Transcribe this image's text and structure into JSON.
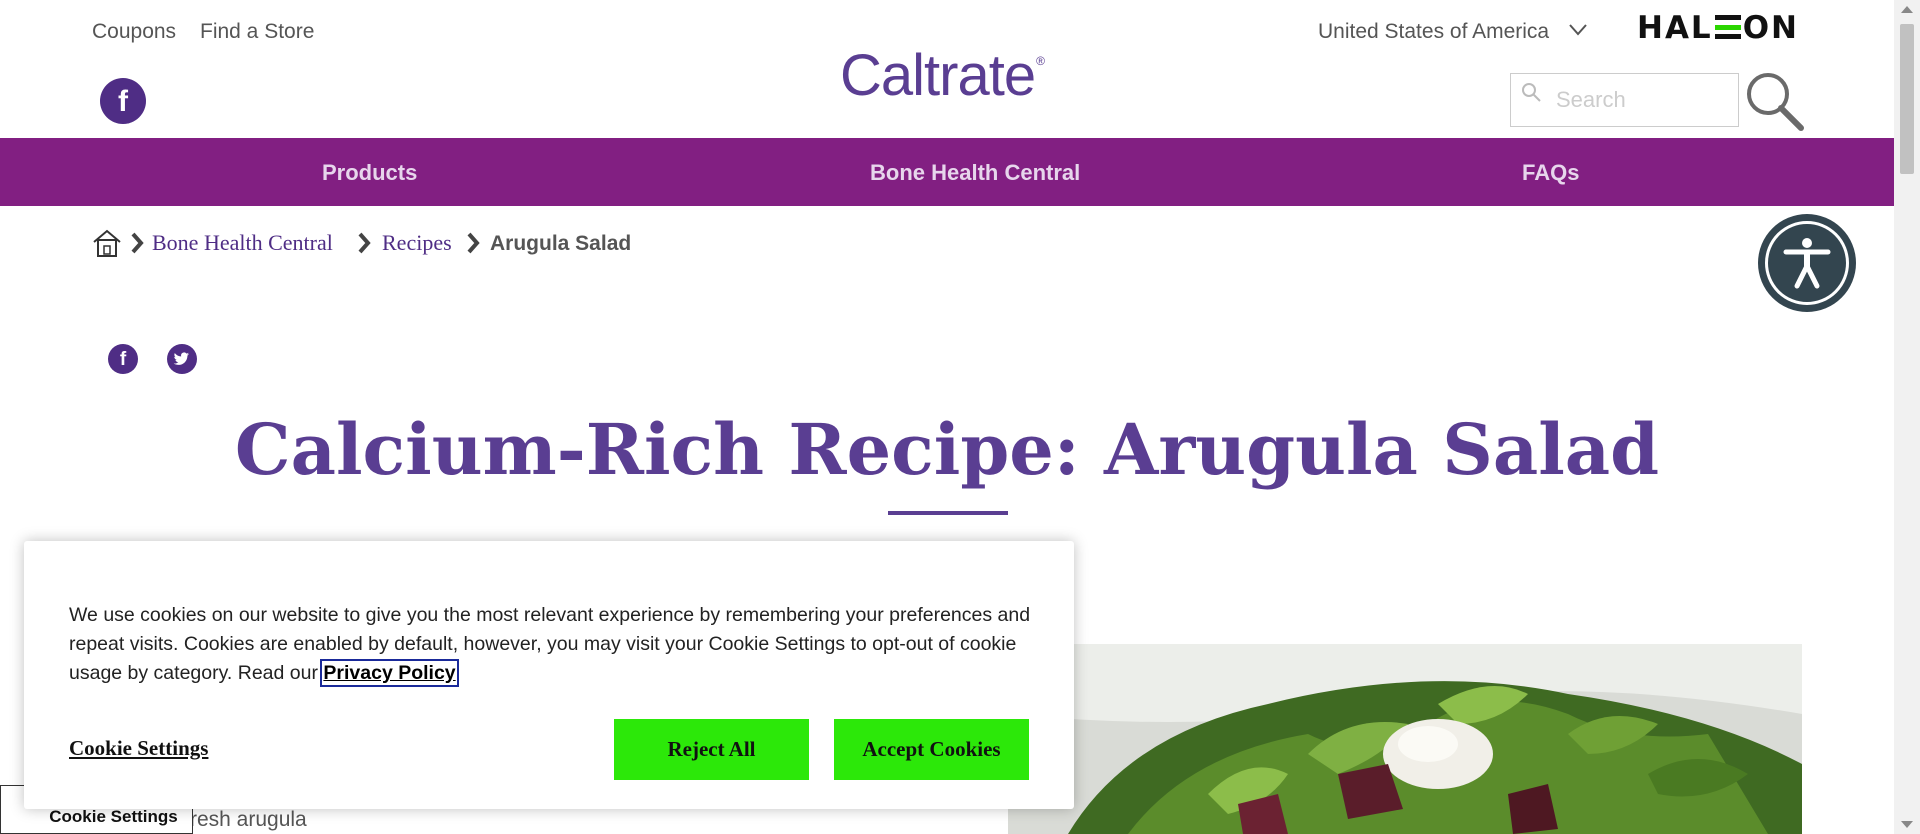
{
  "utility": {
    "coupons": "Coupons",
    "find_store": "Find a Store",
    "country": "United States of America",
    "brand_parent": "HALEON"
  },
  "logo": {
    "text": "Caltrate",
    "mark": "®"
  },
  "search": {
    "placeholder": "Search"
  },
  "nav": {
    "items": [
      {
        "label": "Products"
      },
      {
        "label": "Bone Health Central"
      },
      {
        "label": "FAQs"
      }
    ]
  },
  "breadcrumb": {
    "items": [
      {
        "label": "Bone Health Central"
      },
      {
        "label": "Recipes"
      },
      {
        "label": "Arugula Salad"
      }
    ]
  },
  "page": {
    "title": "Calcium-Rich Recipe: Arugula Salad",
    "visible_ingredient": "resh arugula"
  },
  "cookie_banner": {
    "text": "We use cookies on our website to give you the most relevant experience by remembering your preferences and repeat visits. Cookies are enabled by default, however, you may visit your Cookie Settings to opt-out of cookie usage by category. Read our ",
    "privacy_link": "Privacy Policy",
    "settings_link": "Cookie Settings",
    "reject_label": "Reject All",
    "accept_label": "Accept Cookies"
  },
  "floating_cookie_settings": "Cookie Settings",
  "colors": {
    "brand_purple": "#4f2d85",
    "nav_magenta": "#821f82",
    "accept_green": "#2ce809",
    "haleon_green": "#2bd600"
  }
}
